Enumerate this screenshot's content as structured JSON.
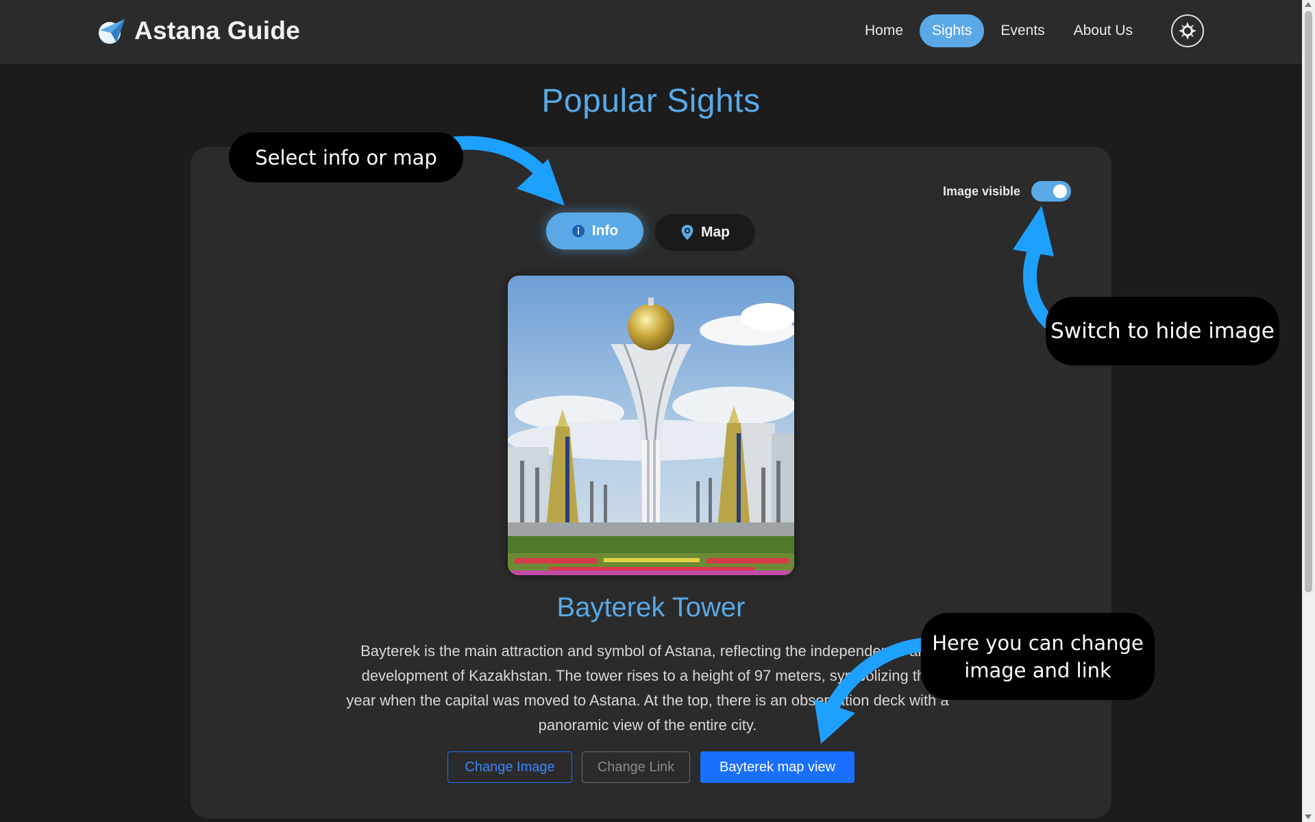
{
  "navbar": {
    "brand": "Astana Guide",
    "links": [
      {
        "label": "Home",
        "active": false
      },
      {
        "label": "Sights",
        "active": true
      },
      {
        "label": "Events",
        "active": false
      },
      {
        "label": "About Us",
        "active": false
      }
    ],
    "theme_toggle_icon": "sun-icon"
  },
  "page": {
    "title": "Popular Sights"
  },
  "card": {
    "image_toggle": {
      "label": "Image visible",
      "checked": true
    },
    "tabs": [
      {
        "label": "Info",
        "icon": "info-icon",
        "active": true
      },
      {
        "label": "Map",
        "icon": "map-pin-icon",
        "active": false
      }
    ],
    "sight": {
      "title": "Bayterek Tower",
      "description": "Bayterek is the main attraction and symbol of Astana, reflecting the independence and development of Kazakhstan. The tower rises to a height of 97 meters, symbolizing the year when the capital was moved to Astana. At the top, there is an observation deck with a panoramic view of the entire city."
    },
    "buttons": {
      "change_image": "Change Image",
      "change_link": "Change Link",
      "map_view": "Bayterek map view"
    }
  },
  "annotations": {
    "select_tab": "Select info or map",
    "hide_image": "Switch to hide image",
    "change_hint": "Here  you can change image and link"
  },
  "colors": {
    "accent": "#5aa9e6",
    "primary_button": "#1a6fff",
    "background": "#1c1c1c",
    "card": "#2b2b2b",
    "annotation_arrow": "#1ea0ff"
  }
}
